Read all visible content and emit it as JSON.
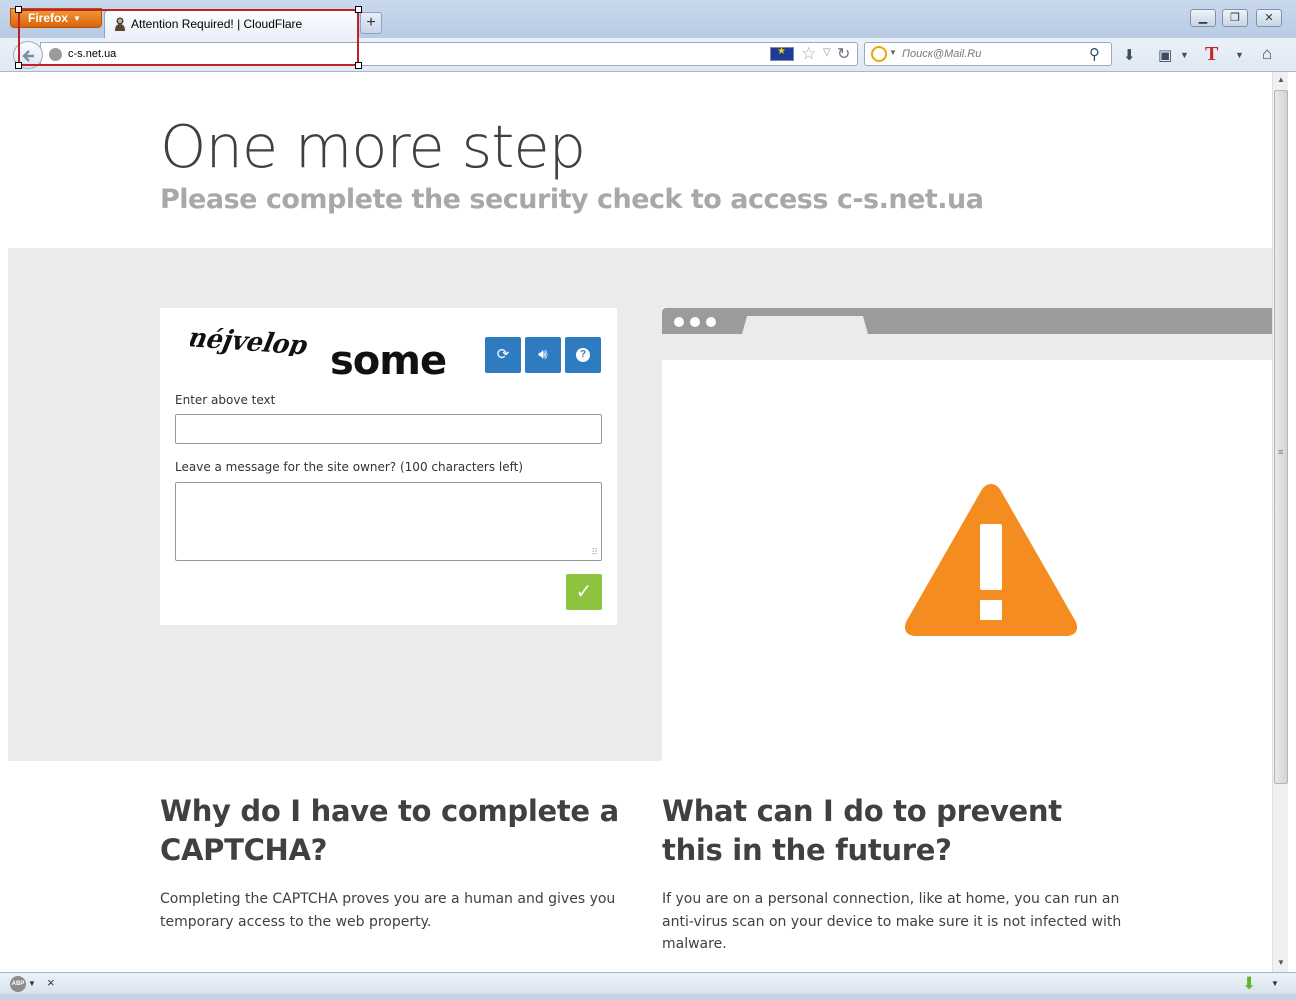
{
  "browser": {
    "menu_button": "Firefox",
    "tab_title": "Attention Required! | CloudFlare",
    "url": "c-s.net.ua",
    "search_placeholder": "Поиск@Mail.Ru",
    "new_tab": "+",
    "icons": {
      "back": "back-arrow-icon",
      "site": "globe-icon",
      "flag": "eu-flag-icon",
      "bookmark": "star-icon",
      "reload": "reload-icon",
      "search_engine": "mailru-search-icon",
      "search_go": "magnifier-icon",
      "downloads": "download-icon",
      "bookmarks_menu": "bookmarks-icon",
      "translit": "t-icon",
      "home": "home-icon"
    }
  },
  "page": {
    "title": "One more step",
    "subtitle": "Please complete the security check to access c-s.net.ua",
    "captcha": {
      "word_distorted": "néjvelop",
      "word_plain": "some",
      "label_text": "Enter above text",
      "label_message": "Leave a message for the site owner? (100 characters left)",
      "input_value": "",
      "message_value": "",
      "submit": "✓"
    },
    "faq": [
      {
        "title": "Why do I have to complete a CAPTCHA?",
        "text": "Completing the CAPTCHA proves you are a human and gives you temporary access to the web property."
      },
      {
        "title": "What can I do to prevent this in the future?",
        "text": "If you are on a personal connection, like at home, you can run an anti-virus scan on your device to make sure it is not infected with malware."
      }
    ],
    "colors": {
      "captcha_button": "#2f7bbf",
      "submit_button": "#8dc33f",
      "warning": "#f48c1f",
      "band": "#ebebeb"
    }
  },
  "addon_bar": {
    "abp_label": "ABP",
    "close": "×"
  }
}
